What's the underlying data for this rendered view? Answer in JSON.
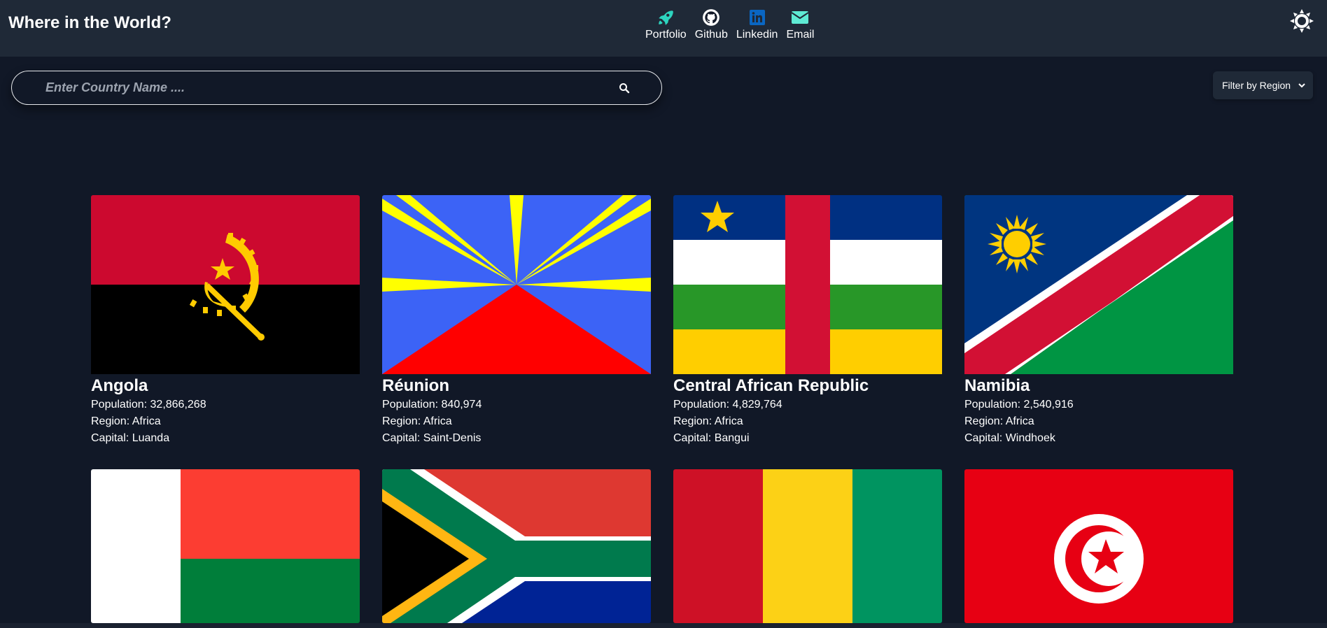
{
  "header": {
    "title": "Where in the World?",
    "links": [
      {
        "label": "Portfolio",
        "icon": "rocket-icon"
      },
      {
        "label": "Github",
        "icon": "github-icon"
      },
      {
        "label": "Linkedin",
        "icon": "linkedin-icon"
      },
      {
        "label": "Email",
        "icon": "envelope-icon"
      }
    ],
    "theme_toggle_icon": "sun-icon"
  },
  "search": {
    "placeholder": "Enter Country Name ....",
    "value": ""
  },
  "filter": {
    "label": "Filter by Region"
  },
  "labels": {
    "population": "Population:",
    "region": "Region:",
    "capital": "Capital:"
  },
  "countries": [
    {
      "name": "Angola",
      "population": "32,866,268",
      "region": "Africa",
      "capital": "Luanda"
    },
    {
      "name": "Réunion",
      "population": "840,974",
      "region": "Africa",
      "capital": "Saint-Denis"
    },
    {
      "name": "Central African Republic",
      "population": "4,829,764",
      "region": "Africa",
      "capital": "Bangui"
    },
    {
      "name": "Namibia",
      "population": "2,540,916",
      "region": "Africa",
      "capital": "Windhoek"
    }
  ],
  "flags_row2": [
    "Madagascar",
    "South Africa",
    "Guinea",
    "Tunisia"
  ],
  "colors": {
    "background": "#111827",
    "header": "#1f2937",
    "rocket": "#2dd4bf",
    "linkedin": "#0a66c2",
    "email": "#5eead4"
  }
}
